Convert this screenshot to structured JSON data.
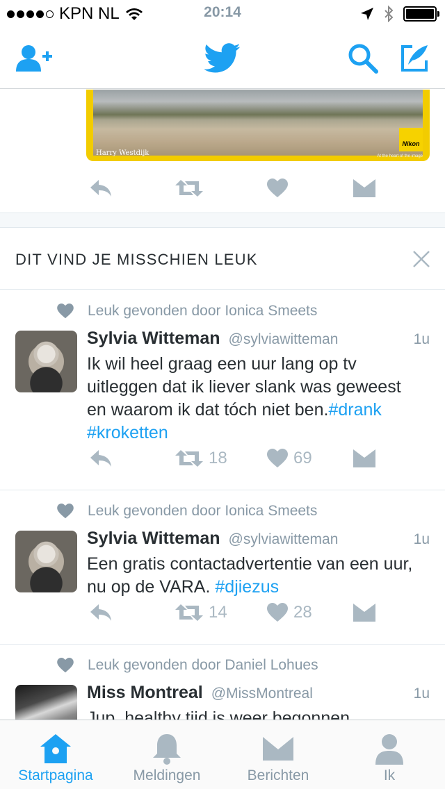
{
  "status_bar": {
    "carrier": "KPN NL",
    "time": "20:14",
    "signal_bars_filled": 4,
    "signal_bars_total": 5
  },
  "nav": {
    "icons": [
      "add-user-icon",
      "twitter-bird-icon",
      "search-icon",
      "compose-icon"
    ]
  },
  "previous_tweet": {
    "media_caption": "Harry Westdijk",
    "media_logo": "Nikon",
    "media_logo_sub": "At the heart of the image"
  },
  "suggestions": {
    "title": "DIT VIND JE MISSCHIEN LEUK"
  },
  "tweets": [
    {
      "liked_by": "Leuk gevonden door Ionica Smeets",
      "name": "Sylvia Witteman",
      "handle": "@sylviawitteman",
      "time": "1u",
      "text": "Ik wil heel graag een uur lang op tv uitleggen dat ik liever slank was geweest en waarom ik dat tóch niet ben.",
      "hashtags": "#drank #kroketten",
      "retweets": "18",
      "likes": "69"
    },
    {
      "liked_by": "Leuk gevonden door Ionica Smeets",
      "name": "Sylvia Witteman",
      "handle": "@sylviawitteman",
      "time": "1u",
      "text": "Een gratis contactadvertentie van een uur, nu op de VARA.",
      "hashtags": "#djiezus",
      "retweets": "14",
      "likes": "28"
    },
    {
      "liked_by": "Leuk gevonden door Daniel Lohues",
      "name": "Miss Montreal",
      "handle": "@MissMontreal",
      "time": "1u",
      "text": "Jup, healthy tijd is weer begonnen."
    }
  ],
  "tab_bar": {
    "tabs": [
      {
        "label": "Startpagina",
        "icon": "home-icon",
        "active": true
      },
      {
        "label": "Meldingen",
        "icon": "bell-icon",
        "active": false
      },
      {
        "label": "Berichten",
        "icon": "envelope-icon",
        "active": false
      },
      {
        "label": "Ik",
        "icon": "person-icon",
        "active": false
      }
    ]
  },
  "colors": {
    "accent": "#1da1f2",
    "muted": "#aab8c2",
    "secondary_text": "#8899a6"
  }
}
